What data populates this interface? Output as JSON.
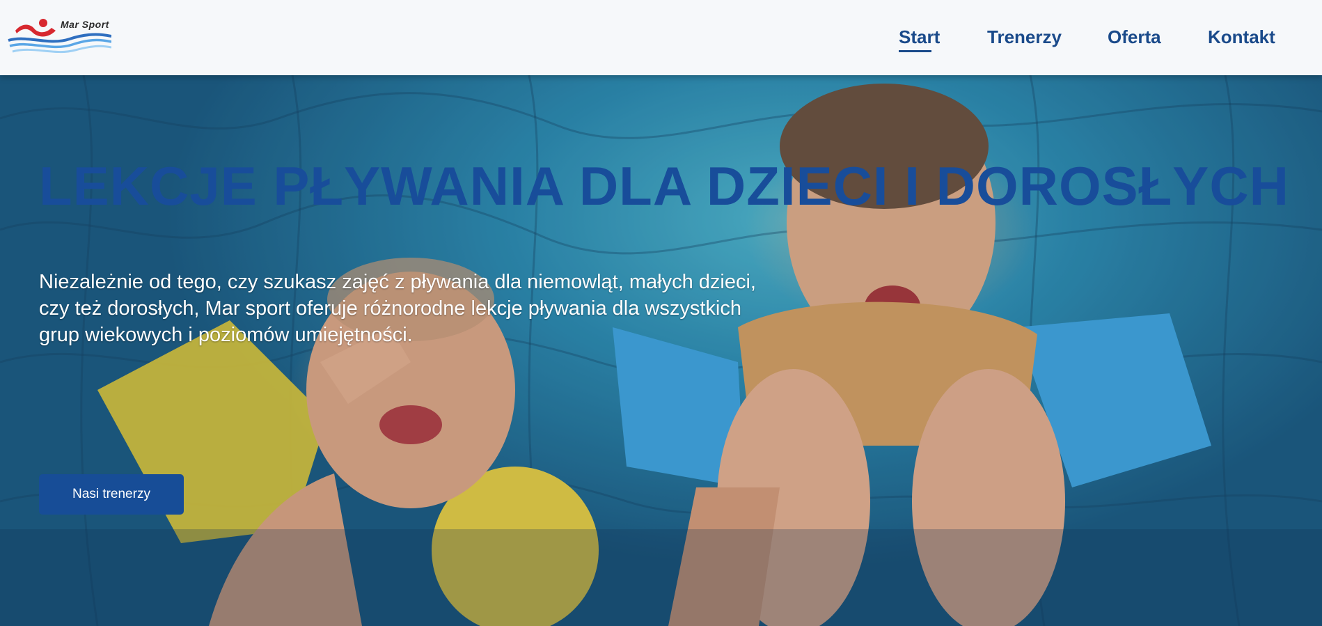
{
  "brand": {
    "name": "Mar Sport",
    "colors": {
      "primary": "#174d97",
      "header_bg": "#f6f8fa",
      "logo_red": "#d7282f",
      "logo_blue": "#3a8fd8"
    }
  },
  "nav": {
    "items": [
      {
        "label": "Start",
        "active": true
      },
      {
        "label": "Trenerzy",
        "active": false
      },
      {
        "label": "Oferta",
        "active": false
      },
      {
        "label": "Kontakt",
        "active": false
      }
    ]
  },
  "hero": {
    "headline": "LEKCJE PŁYWANIA DLA DZIECI I DOROSŁYCH",
    "subtext": "Niezależnie od tego, czy szukasz zajęć z pływania dla niemowląt, małych dzieci, czy też dorosłych, Mar sport oferuje różnorodne lekcje pływania dla wszystkich grup wiekowych i poziomów umiejętności.",
    "cta_label": "Nasi trenerzy",
    "background_image": "children-in-pool-photo"
  }
}
